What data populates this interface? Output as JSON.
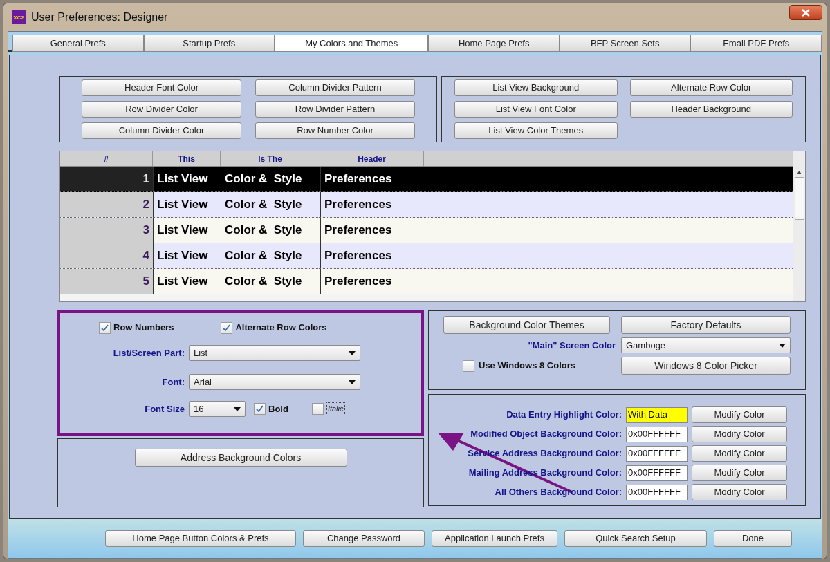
{
  "window": {
    "title": "User Preferences: Designer",
    "logo": "XC2"
  },
  "tabs": [
    {
      "label": "General Prefs",
      "selected": false
    },
    {
      "label": "Startup Prefs",
      "selected": false
    },
    {
      "label": "My Colors and Themes",
      "selected": true
    },
    {
      "label": "Home Page Prefs",
      "selected": false
    },
    {
      "label": "BFP Screen Sets",
      "selected": false
    },
    {
      "label": "Email PDF Prefs",
      "selected": false
    }
  ],
  "color_buttons": {
    "left": [
      "Header Font Color",
      "Column Divider Pattern",
      "Row Divider Color",
      "Row Divider Pattern",
      "Column Divider Color",
      "Row Number Color"
    ],
    "right": [
      "List View Background",
      "Alternate Row Color",
      "List View Font Color",
      "Header Background",
      "List View Color Themes"
    ]
  },
  "list_preview": {
    "columns": [
      "#",
      "This",
      "Is The",
      "Header"
    ],
    "rows": [
      {
        "cells": [
          "1",
          "List View",
          "Color &  Style",
          "Preferences"
        ],
        "selected": true
      },
      {
        "cells": [
          "2",
          "List View",
          "Color &  Style",
          "Preferences"
        ],
        "selected": false
      },
      {
        "cells": [
          "3",
          "List View",
          "Color &  Style",
          "Preferences"
        ],
        "selected": false
      },
      {
        "cells": [
          "4",
          "List View",
          "Color &  Style",
          "Preferences"
        ],
        "selected": false
      },
      {
        "cells": [
          "5",
          "List View",
          "Color &  Style",
          "Preferences"
        ],
        "selected": false
      }
    ]
  },
  "list_settings": {
    "row_numbers": {
      "label": "Row Numbers",
      "checked": true
    },
    "alternate_row_colors": {
      "label": "Alternate Row Colors",
      "checked": true
    },
    "screen_part": {
      "label": "List/Screen Part:",
      "value": "List"
    },
    "font": {
      "label": "Font:",
      "value": "Arial"
    },
    "font_size": {
      "label": "Font Size",
      "value": "16"
    },
    "bold": {
      "label": "Bold",
      "checked": true
    },
    "italic": {
      "label": "Italic",
      "checked": false
    }
  },
  "address_button": "Address Background Colors",
  "themes": {
    "themes_button": "Background Color Themes",
    "defaults_button": "Factory Defaults",
    "main_color": {
      "label": "\"Main\" Screen Color",
      "value": "Gamboge"
    },
    "windows8": {
      "label": "Use Windows 8 Colors",
      "checked": false
    },
    "picker_button": "Windows 8 Color Picker"
  },
  "highlight_rows": [
    {
      "kind": "highlight",
      "label": "Data Entry Highlight Color:",
      "value": "With Data",
      "button": "Modify Color"
    },
    {
      "kind": "hex",
      "label": "Modified Object Background Color:",
      "value": "0x00FFFFFF",
      "button": "Modify Color"
    },
    {
      "kind": "hex",
      "label": "Service Address Background Color:",
      "value": "0x00FFFFFF",
      "button": "Modify Color"
    },
    {
      "kind": "hex",
      "label": "Mailing Address Background Color:",
      "value": "0x00FFFFFF",
      "button": "Modify Color"
    },
    {
      "kind": "hex",
      "label": "All Others Background Color:",
      "value": "0x00FFFFFF",
      "button": "Modify Color"
    }
  ],
  "footer_buttons": [
    "Home Page Button Colors & Prefs",
    "Change Password",
    "Application Launch Prefs",
    "Quick Search Setup",
    "Done"
  ]
}
